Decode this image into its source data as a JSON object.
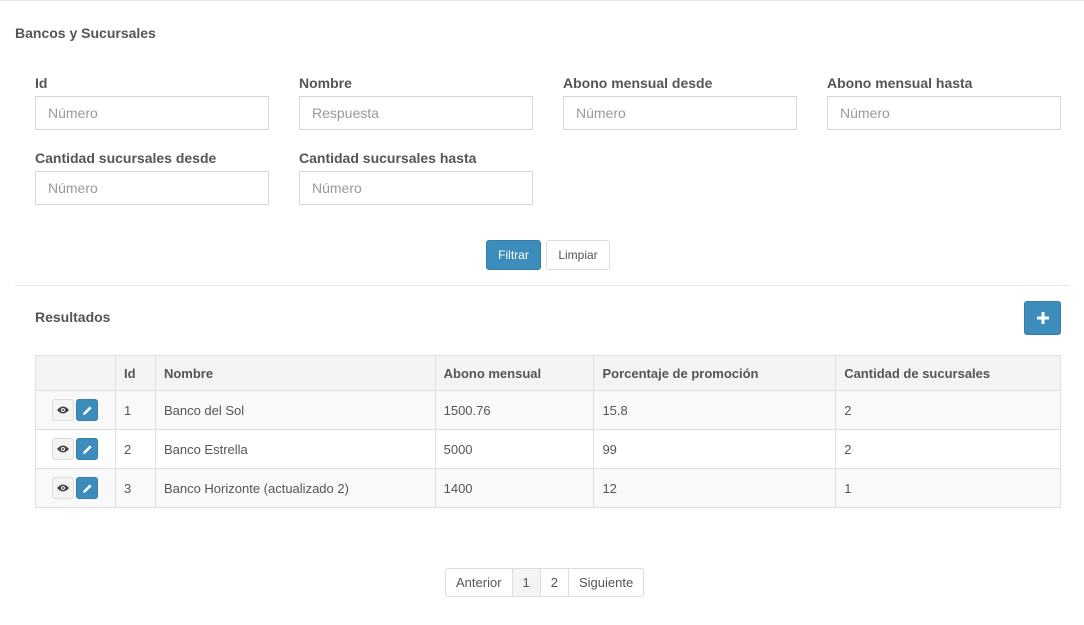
{
  "section": {
    "title": "Bancos y Sucursales"
  },
  "filters": {
    "id": {
      "label": "Id",
      "placeholder": "Número",
      "value": ""
    },
    "nombre": {
      "label": "Nombre",
      "placeholder": "Respuesta",
      "value": ""
    },
    "abono_desde": {
      "label": "Abono mensual desde",
      "placeholder": "Número",
      "value": ""
    },
    "abono_hasta": {
      "label": "Abono mensual hasta",
      "placeholder": "Número",
      "value": ""
    },
    "cant_desde": {
      "label": "Cantidad sucursales desde",
      "placeholder": "Número",
      "value": ""
    },
    "cant_hasta": {
      "label": "Cantidad sucursales hasta",
      "placeholder": "Número",
      "value": ""
    },
    "filter_label": "Filtrar",
    "clear_label": "Limpiar"
  },
  "results": {
    "title": "Resultados",
    "add_icon": "plus-icon",
    "columns": [
      "",
      "Id",
      "Nombre",
      "Abono mensual",
      "Porcentaje de promoción",
      "Cantidad de sucursales"
    ],
    "rows": [
      {
        "id": "1",
        "nombre": "Banco del Sol",
        "abono": "1500.76",
        "porcentaje": "15.8",
        "sucursales": "2"
      },
      {
        "id": "2",
        "nombre": "Banco Estrella",
        "abono": "5000",
        "porcentaje": "99",
        "sucursales": "2"
      },
      {
        "id": "3",
        "nombre": "Banco Horizonte (actualizado 2)",
        "abono": "1400",
        "porcentaje": "12",
        "sucursales": "1"
      }
    ],
    "row_actions": {
      "view_icon": "eye-icon",
      "edit_icon": "pencil-icon"
    }
  },
  "pagination": {
    "prev_label": "Anterior",
    "pages": [
      "1",
      "2"
    ],
    "current": "1",
    "next_label": "Siguiente"
  },
  "colors": {
    "primary": "#3c8dbc",
    "text": "#555555",
    "border": "#dddddd"
  }
}
